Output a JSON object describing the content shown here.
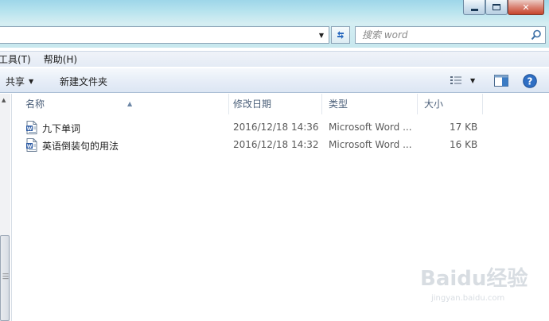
{
  "search": {
    "placeholder": "搜索 word"
  },
  "menubar": {
    "items": [
      "工具(T)",
      "帮助(H)"
    ]
  },
  "toolbar": {
    "share_label": "共享",
    "new_folder_label": "新建文件夹"
  },
  "columns": {
    "name": "名称",
    "modified": "修改日期",
    "type": "类型",
    "size": "大小"
  },
  "files": [
    {
      "name": "九下单词",
      "modified": "2016/12/18 14:36",
      "type": "Microsoft Word ...",
      "size": "17 KB",
      "icon": "word-document-icon"
    },
    {
      "name": "英语倒装句的用法",
      "modified": "2016/12/18 14:32",
      "type": "Microsoft Word ...",
      "size": "16 KB",
      "icon": "word-document-icon"
    }
  ],
  "watermark": {
    "logo": "Baidu经验",
    "url": "jingyan.baidu.com"
  },
  "colors": {
    "accent": "#1e5aa8",
    "header_text": "#4c607a",
    "titlebar": "#b6e3ee"
  }
}
